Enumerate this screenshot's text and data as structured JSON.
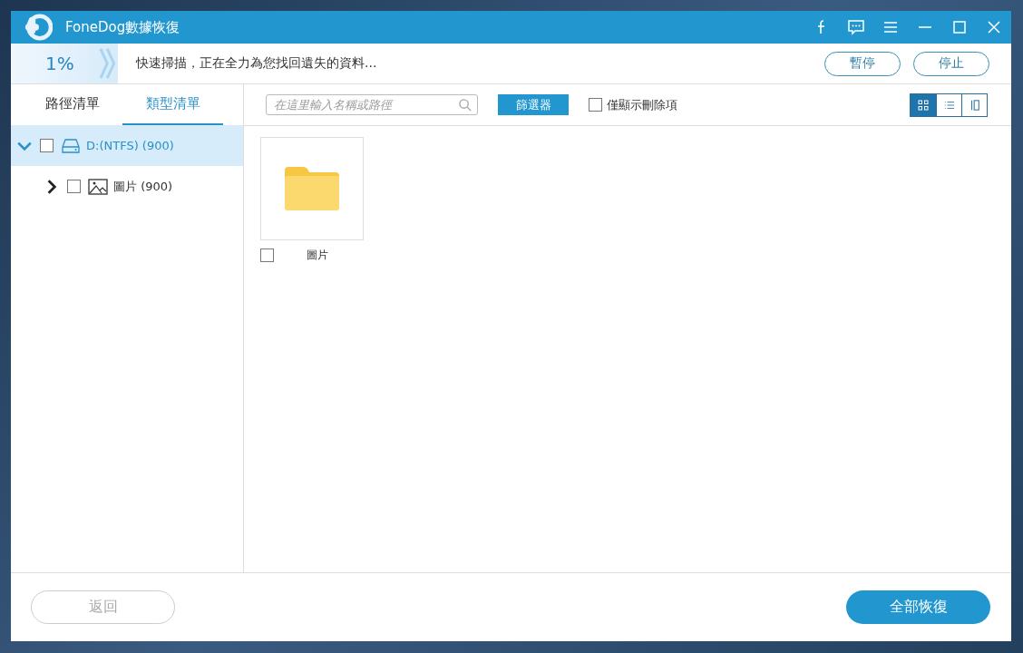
{
  "window": {
    "title": "FoneDog數據恢復"
  },
  "scan": {
    "percent": "1%",
    "status": "快速掃描，正在全力為您找回遺失的資料...",
    "buttons": [
      "暫停",
      "停止"
    ]
  },
  "sidebar": {
    "tabs": [
      {
        "label": "路徑清單",
        "selected": false
      },
      {
        "label": "類型清單",
        "selected": true
      }
    ],
    "tree": [
      {
        "label": "D:(NTFS) (900)",
        "kind": "drive",
        "expanded": true,
        "checked": false,
        "selected": true,
        "children": [
          {
            "label": "圖片 (900)",
            "kind": "images",
            "expanded": false,
            "checked": false,
            "selected": false
          }
        ]
      }
    ]
  },
  "toolbar": {
    "search": {
      "placeholder": "在這里輸入名稱或路徑"
    },
    "filter_button": "篩選器",
    "deleted_only": {
      "label": "僅顯示刪除項",
      "checked": false
    },
    "views": [
      {
        "kind": "grid",
        "selected": true
      },
      {
        "kind": "list",
        "selected": false
      },
      {
        "kind": "columns",
        "selected": false
      }
    ]
  },
  "files": [
    {
      "name": "圖片",
      "checked": false
    }
  ],
  "footer": {
    "back": {
      "label": "返回",
      "disabled": true
    },
    "recover": "全部恢復"
  }
}
